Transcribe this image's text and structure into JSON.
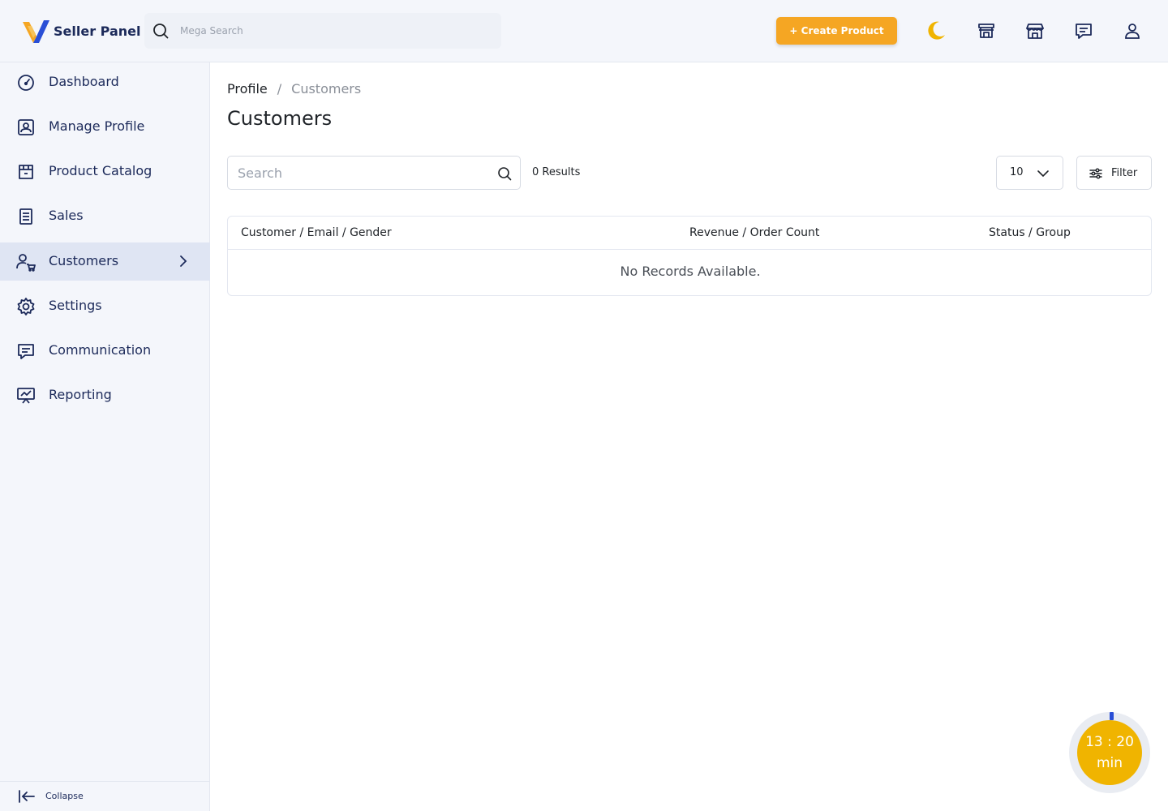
{
  "header": {
    "brand_title": "Seller Panel",
    "mega_search_placeholder": "Mega Search",
    "create_button_label": "+ Create Product",
    "icons": [
      "moon-icon",
      "store-icon",
      "shop-icon",
      "chat-icon",
      "user-icon"
    ]
  },
  "sidebar": {
    "items": [
      {
        "label": "Dashboard",
        "icon": "gauge-icon",
        "active": false
      },
      {
        "label": "Manage Profile",
        "icon": "profile-icon",
        "active": false
      },
      {
        "label": "Product Catalog",
        "icon": "catalog-icon",
        "active": false
      },
      {
        "label": "Sales",
        "icon": "receipt-icon",
        "active": false
      },
      {
        "label": "Customers",
        "icon": "customers-icon",
        "active": true
      },
      {
        "label": "Settings",
        "icon": "gear-icon",
        "active": false
      },
      {
        "label": "Communication",
        "icon": "chat-icon",
        "active": false
      },
      {
        "label": "Reporting",
        "icon": "presentation-icon",
        "active": false
      }
    ],
    "collapse_label": "Collapse"
  },
  "breadcrumb": {
    "parent": "Profile",
    "separator": "/",
    "current": "Customers"
  },
  "page": {
    "title": "Customers",
    "search_placeholder": "Search",
    "results_text": "0 Results",
    "page_size": "10",
    "filter_label": "Filter"
  },
  "table": {
    "columns": [
      "Customer / Email / Gender",
      "Revenue / Order Count",
      "Status / Group"
    ],
    "empty_text": "No Records Available."
  },
  "timer": {
    "time": "13 : 20",
    "unit": "min"
  },
  "colors": {
    "accent": "#f5a623",
    "brand_dark": "#1c2a5a",
    "active_nav_bg": "#dfe5f3",
    "timer_fill": "#f0b400"
  }
}
